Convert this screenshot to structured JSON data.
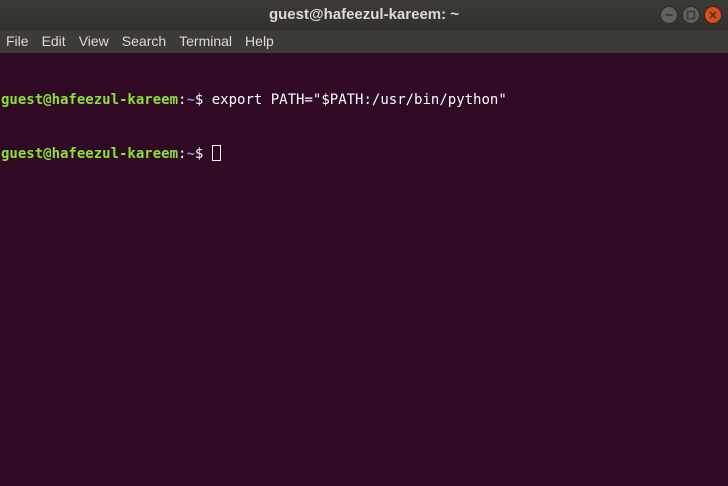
{
  "window": {
    "title": "guest@hafeezul-kareem: ~"
  },
  "menu": {
    "items": [
      "File",
      "Edit",
      "View",
      "Search",
      "Terminal",
      "Help"
    ]
  },
  "terminal": {
    "lines": [
      {
        "user_host": "guest@hafeezul-kareem",
        "sep": ":",
        "path": "~",
        "prompt": "$",
        "command": " export PATH=\"$PATH:/usr/bin/python\""
      },
      {
        "user_host": "guest@hafeezul-kareem",
        "sep": ":",
        "path": "~",
        "prompt": "$",
        "command": " "
      }
    ]
  },
  "colors": {
    "background": "#300a24",
    "user_host": "#8ae234",
    "path": "#729fcf",
    "titlebar": "#3c3b37",
    "close_button": "#df4a16"
  },
  "icons": {
    "minimize": "minimize-icon",
    "maximize": "maximize-icon",
    "close": "close-icon"
  }
}
